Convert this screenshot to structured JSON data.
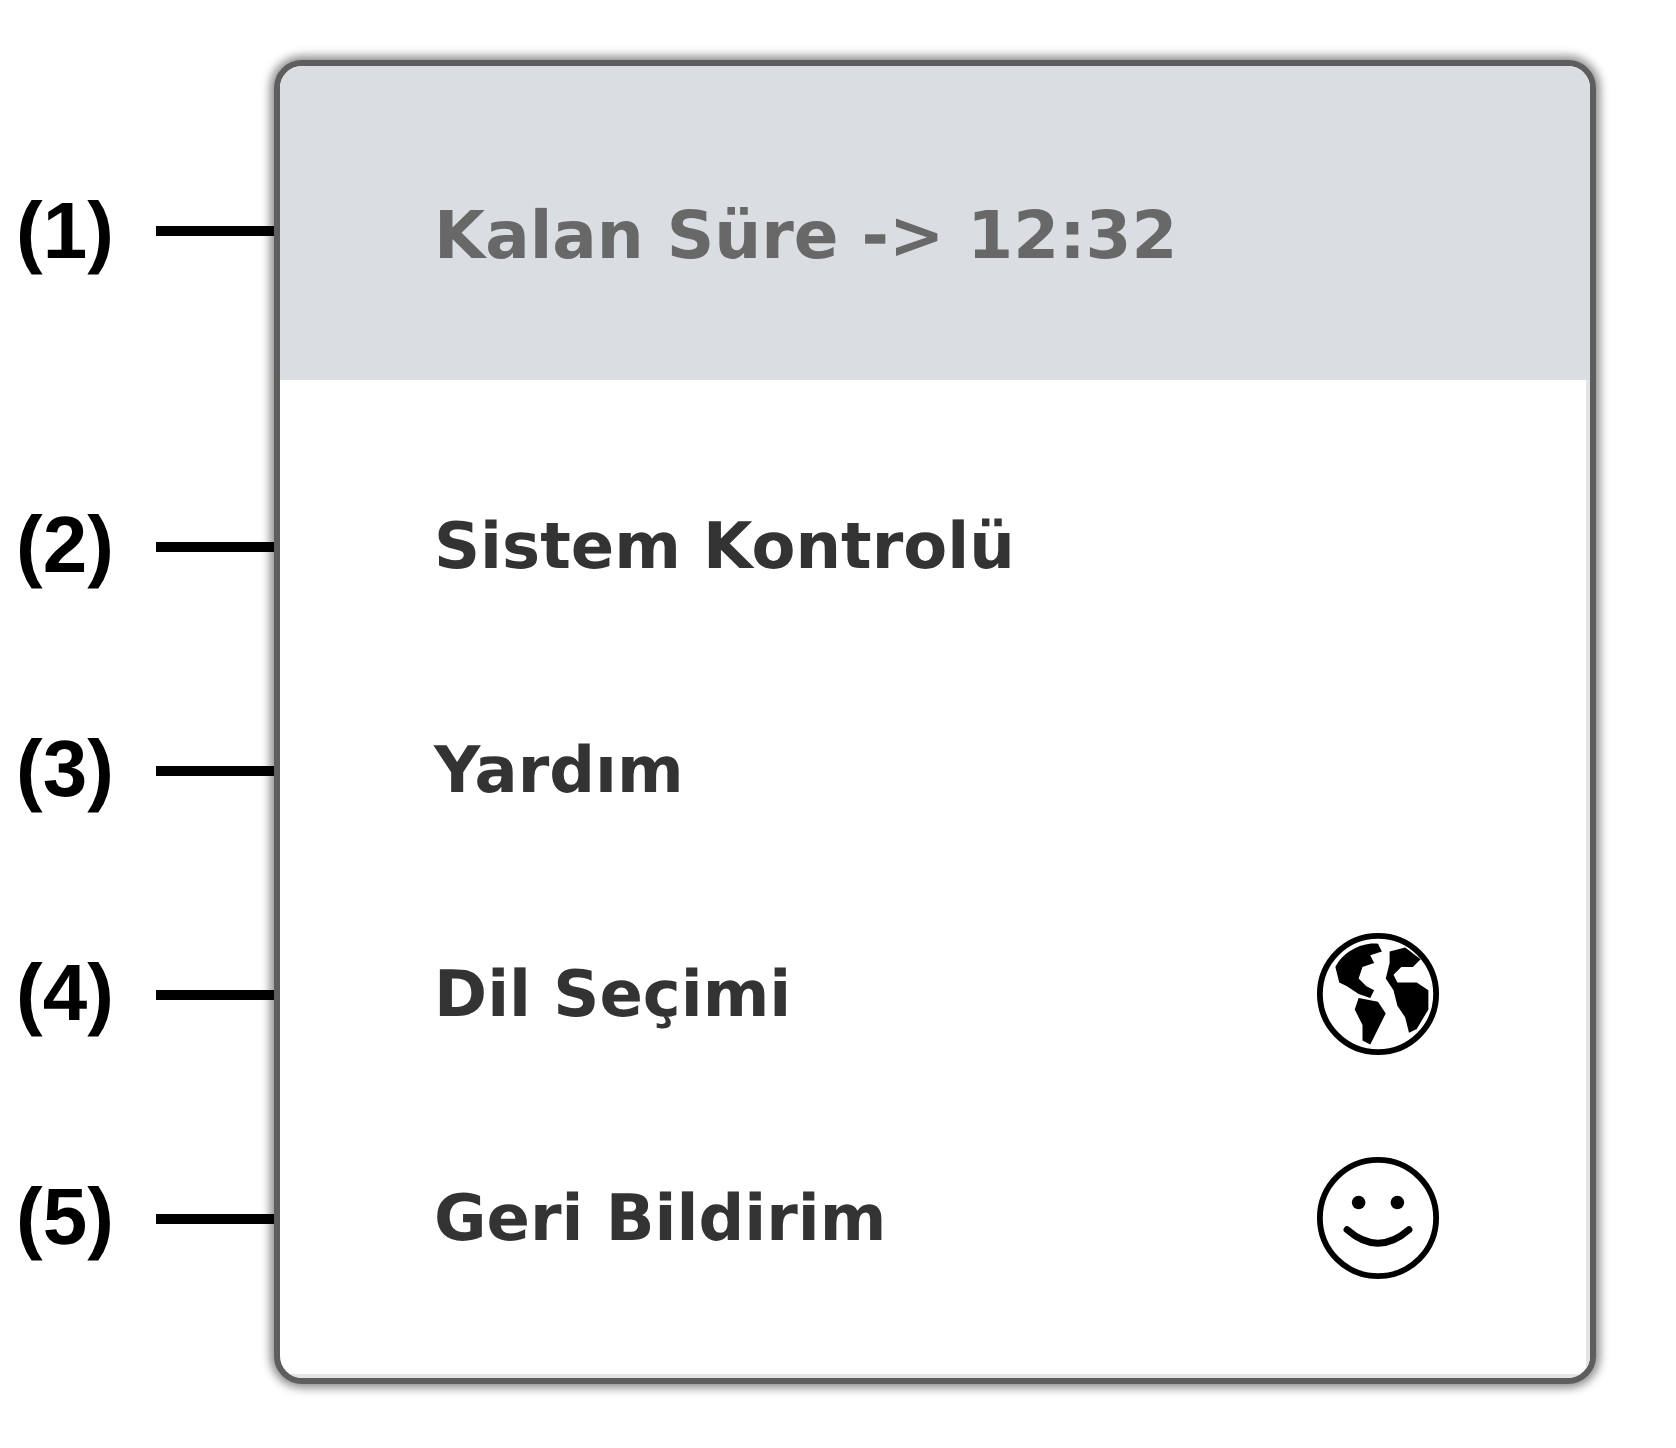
{
  "callouts": [
    {
      "label": "(1)"
    },
    {
      "label": "(2)"
    },
    {
      "label": "(3)"
    },
    {
      "label": "(4)"
    },
    {
      "label": "(5)"
    }
  ],
  "menu": {
    "header": {
      "text": "Kalan Süre -> 12:32"
    },
    "items": [
      {
        "label": "Sistem Kontrolü",
        "kind": "plain"
      },
      {
        "label": "Yardım",
        "kind": "plain"
      },
      {
        "label": "Dil Seçimi",
        "kind": "language"
      },
      {
        "label": "Geri Bildirim",
        "kind": "feedback"
      }
    ]
  }
}
